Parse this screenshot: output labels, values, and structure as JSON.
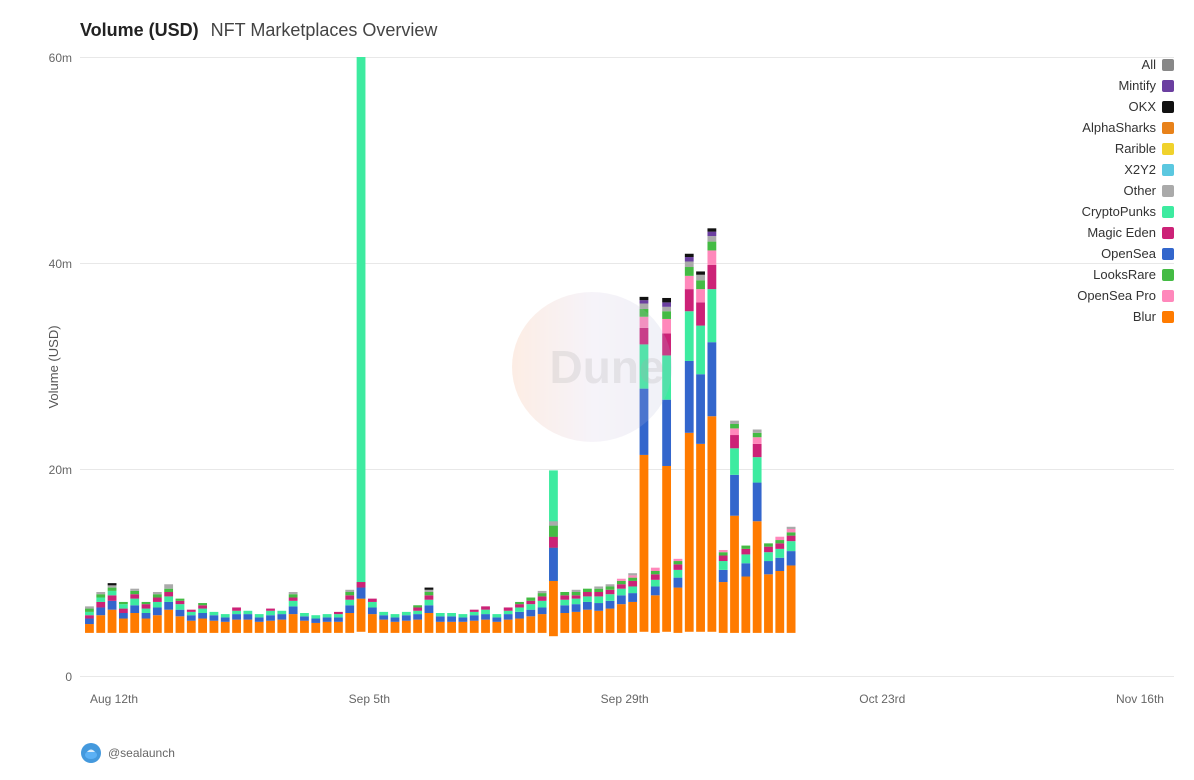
{
  "title": {
    "volume_label": "Volume (USD)",
    "subtitle": "NFT Marketplaces Overview"
  },
  "y_axis": {
    "label": "Volume (USD)",
    "ticks": [
      "60m",
      "40m",
      "20m",
      "0"
    ]
  },
  "x_axis": {
    "labels": [
      "Aug 12th",
      "Sep 5th",
      "Sep 29th",
      "Oct 23rd",
      "Nov 16th"
    ]
  },
  "watermark": "Dune",
  "footer": "@sealaunch",
  "legend": [
    {
      "label": "All",
      "color": "#888888"
    },
    {
      "label": "Mintify",
      "color": "#6B3FA0"
    },
    {
      "label": "OKX",
      "color": "#111111"
    },
    {
      "label": "AlphaSharks",
      "color": "#E8821A"
    },
    {
      "label": "Rarible",
      "color": "#F0D22C"
    },
    {
      "label": "X2Y2",
      "color": "#5BC8E0"
    },
    {
      "label": "Other",
      "color": "#AAAAAA"
    },
    {
      "label": "CryptoPunks",
      "color": "#3DEBA0"
    },
    {
      "label": "Magic Eden",
      "color": "#CC2277"
    },
    {
      "label": "OpenSea",
      "color": "#3366CC"
    },
    {
      "label": "LooksRare",
      "color": "#44BB44"
    },
    {
      "label": "OpenSea Pro",
      "color": "#FF88BB"
    },
    {
      "label": "Blur",
      "color": "#FF7B00"
    }
  ]
}
